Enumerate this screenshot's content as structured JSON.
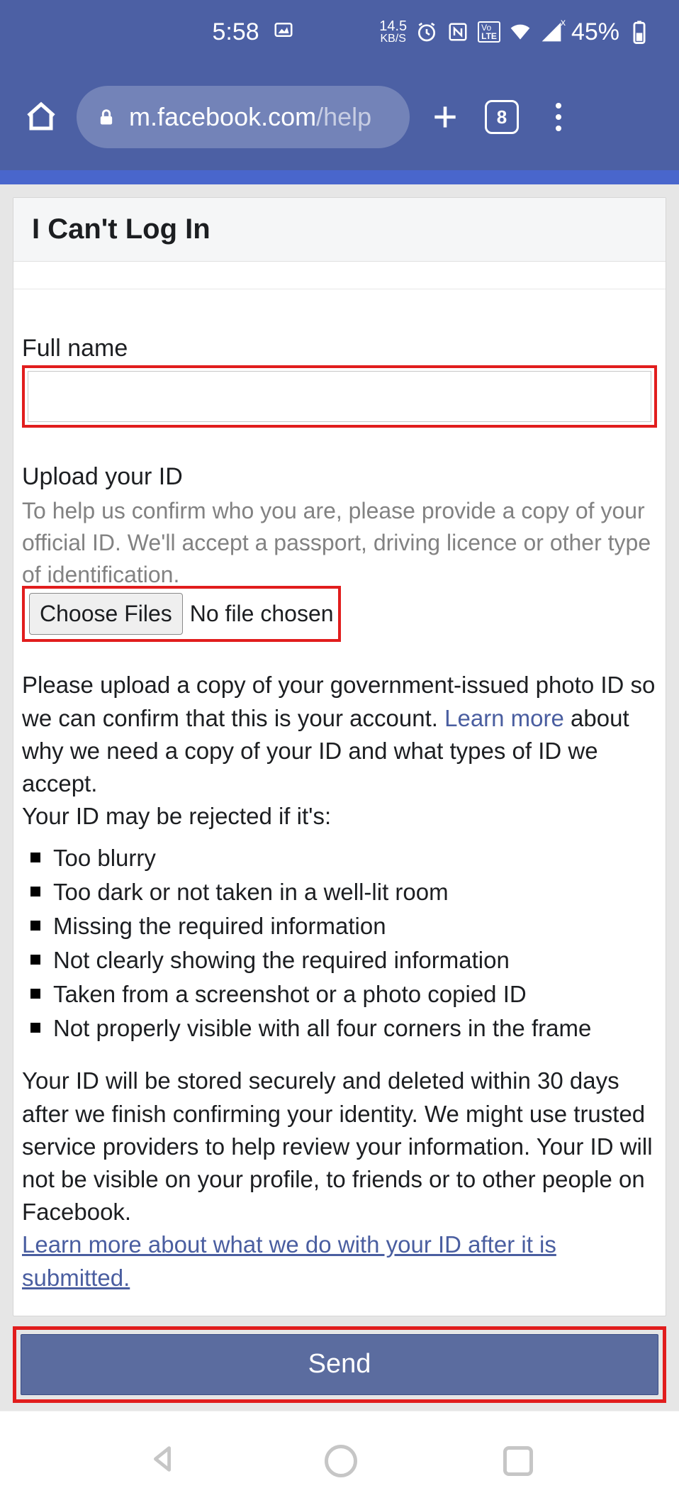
{
  "status": {
    "time": "5:58",
    "net_speed_top": "14.5",
    "net_speed_bottom": "KB/S",
    "lte_badge": "LTE",
    "vo_badge": "Vo",
    "battery_pct": "45%",
    "tab_count": "8"
  },
  "browser": {
    "url_host": "m.facebook.com",
    "url_path": "/help"
  },
  "page": {
    "title": "I Can't Log In",
    "full_name_label": "Full name",
    "upload_label": "Upload your ID",
    "upload_help": "To help us confirm who you are, please provide a copy of your official ID. We'll accept a passport, driving licence or other type of identification.",
    "choose_files": "Choose Files",
    "no_file": "No file chosen",
    "para1_a": "Please upload a copy of your government-issued photo ID so we can confirm that this is your account. ",
    "learn_more": "Learn more",
    "para1_b": " about why we need a copy of your ID and what types of ID we accept.",
    "rejected_intro": "Your ID may be rejected if it's:",
    "bullets": [
      "Too blurry",
      "Too dark or not taken in a well-lit room",
      "Missing the required information",
      "Not clearly showing the required information",
      "Taken from a screenshot or a photo copied ID",
      "Not properly visible with all four corners in the frame"
    ],
    "storage_para": "Your ID will be stored securely and deleted within 30 days after we finish confirming your identity. We might use trusted service providers to help review your information. Your ID will not be visible on your profile, to friends or to other people on Facebook.",
    "learn_more_2": "Learn more about what we do with your ID after it is submitted.",
    "send": "Send"
  }
}
